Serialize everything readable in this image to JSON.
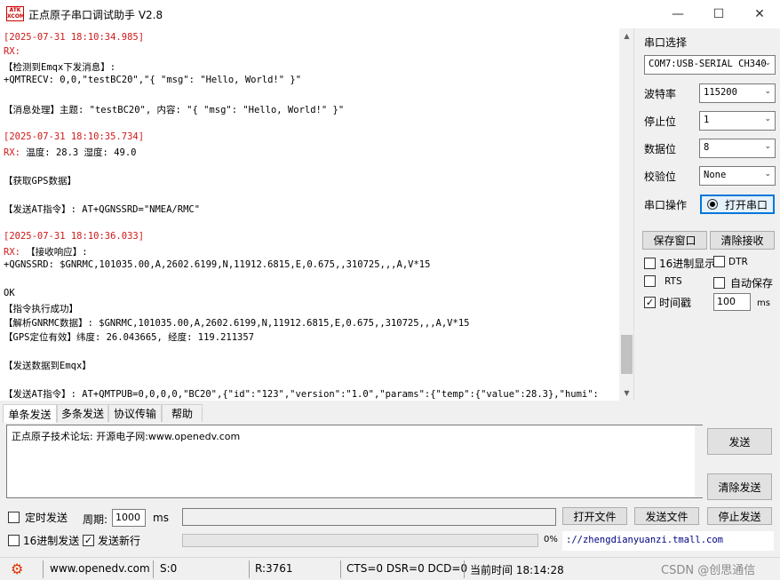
{
  "window": {
    "title": "正点原子串口调试助手 V2.8",
    "logo_text": "ATK XCOM",
    "minimize": "—",
    "maximize": "☐",
    "close": "✕"
  },
  "receive": {
    "lines": [
      {
        "text": "[2025-07-31 18:10:34.985]",
        "color": "red"
      },
      {
        "text": "RX:",
        "color": "red"
      },
      {
        "text": "【检测到Emqx下发消息】:",
        "color": "black"
      },
      {
        "text": "+QMTRECV: 0,0,\"testBC20\",\"{ \"msg\": \"Hello, World!\" }\"",
        "color": "black"
      },
      {
        "text": "",
        "color": "black"
      },
      {
        "text": "【消息处理】主题: \"testBC20\", 内容: \"{ \"msg\": \"Hello, World!\" }\"",
        "color": "black"
      },
      {
        "text": "",
        "color": "black"
      },
      {
        "text": "[2025-07-31 18:10:35.734]",
        "color": "red"
      },
      {
        "text": "RX: 温度: 28.3  湿度: 49.0",
        "color": "mixed",
        "prefix": "RX: ",
        "rest": "温度: 28.3  湿度: 49.0"
      },
      {
        "text": "",
        "color": "black"
      },
      {
        "text": "【获取GPS数据】",
        "color": "black"
      },
      {
        "text": "",
        "color": "black"
      },
      {
        "text": "【发送AT指令】: AT+QGNSSRD=\"NMEA/RMC\"",
        "color": "black"
      },
      {
        "text": "",
        "color": "black"
      },
      {
        "text": "[2025-07-31 18:10:36.033]",
        "color": "red"
      },
      {
        "text": "RX: 【接收响应】:",
        "color": "mixed",
        "prefix": "RX: ",
        "rest": "【接收响应】:"
      },
      {
        "text": "+QGNSSRD: $GNRMC,101035.00,A,2602.6199,N,11912.6815,E,0.675,,310725,,,A,V*15",
        "color": "black"
      },
      {
        "text": "",
        "color": "black"
      },
      {
        "text": "OK",
        "color": "black"
      },
      {
        "text": "【指令执行成功】",
        "color": "black"
      },
      {
        "text": "【解析GNRMC数据】: $GNRMC,101035.00,A,2602.6199,N,11912.6815,E,0.675,,310725,,,A,V*15",
        "color": "black"
      },
      {
        "text": "【GPS定位有效】纬度: 26.043665, 经度: 119.211357",
        "color": "black"
      },
      {
        "text": "",
        "color": "black"
      },
      {
        "text": "【发送数据到Emqx】",
        "color": "black"
      },
      {
        "text": "",
        "color": "black"
      },
      {
        "text": "【发送AT指令】: AT+QMTPUB=0,0,0,0,\"BC20\",{\"id\":\"123\",\"version\":\"1.0\",\"params\":{\"temp\":{\"value\":28.3},\"humi\":",
        "color": "black"
      }
    ]
  },
  "settings": {
    "port_label": "串口选择",
    "port_value": "COM7:USB-SERIAL CH340",
    "baud_label": "波特率",
    "baud_value": "115200",
    "stop_label": "停止位",
    "stop_value": "1",
    "data_label": "数据位",
    "data_value": "8",
    "parity_label": "校验位",
    "parity_value": "None",
    "op_label": "串口操作",
    "open_button": "打开串口",
    "save_window": "保存窗口",
    "clear_receive": "清除接收",
    "hex_display": "16进制显示",
    "dtr": "DTR",
    "rts": "RTS",
    "auto_save": "自动保存",
    "timestamp": "时间戳",
    "timestamp_value": "100",
    "timestamp_unit": "ms",
    "chevron": "⌄"
  },
  "tabs": [
    {
      "label": "单条发送"
    },
    {
      "label": "多条发送"
    },
    {
      "label": "协议传输"
    },
    {
      "label": "帮助"
    }
  ],
  "send": {
    "text": "正点原子技术论坛: 开源电子网:www.openedv.com",
    "send_button": "发送",
    "clear_send": "清除发送",
    "timed_send": "定时发送",
    "period_label": "周期:",
    "period_value": "1000",
    "period_unit": "ms",
    "open_file": "打开文件",
    "send_file": "发送文件",
    "stop_send": "停止发送",
    "hex_send": "16进制发送",
    "send_newline": "发送新行",
    "progress_percent": "0%",
    "progress": 0,
    "url": "://zhengdianyuanzi.tmall.com"
  },
  "status": {
    "website": "www.openedv.com",
    "sent": "S:0",
    "received": "R:3761",
    "lines": "CTS=0 DSR=0 DCD=0",
    "time": "当前时间 18:14:28",
    "watermark": "CSDN @创思通信"
  }
}
